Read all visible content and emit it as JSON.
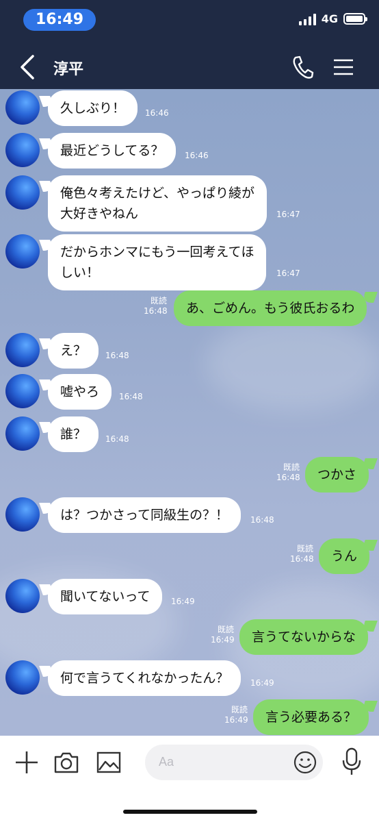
{
  "status_bar": {
    "time": "16:49",
    "network": "4G"
  },
  "header": {
    "title": "淳平"
  },
  "messages": [
    {
      "text": "久しぶり！",
      "time": "16:46"
    },
    {
      "text": "最近どうしてる？",
      "time": "16:46"
    },
    {
      "lines": [
        "俺色々考えたけど、やっぱり綾が",
        "大好きやねん"
      ],
      "time": "16:47"
    },
    {
      "lines": [
        "だからホンマにもう一回考えてほ",
        "しい！"
      ],
      "time": "16:47"
    },
    {
      "text": "あ、ごめん。もう彼氏おるわ",
      "read": "既読",
      "time": "16:48"
    },
    {
      "text": "え？",
      "time": "16:48"
    },
    {
      "text": "嘘やろ",
      "time": "16:48"
    },
    {
      "text": "誰？",
      "time": "16:48"
    },
    {
      "text": "つかさ",
      "read": "既読",
      "time": "16:48"
    },
    {
      "text": "は？つかさって同級生の？！",
      "time": "16:48"
    },
    {
      "text": "うん",
      "read": "既読",
      "time": "16:48"
    },
    {
      "text": "聞いてないって",
      "time": "16:49"
    },
    {
      "text": "言うてないからな",
      "read": "既読",
      "time": "16:49"
    },
    {
      "text": "何で言うてくれなかったん？",
      "time": "16:49"
    },
    {
      "text": "言う必要ある？",
      "read": "既読",
      "time": "16:49"
    }
  ],
  "input": {
    "placeholder": "Aa"
  },
  "icons": {
    "back": "chevron-left-icon",
    "call": "phone-icon",
    "menu": "hamburger-icon",
    "add": "plus-icon",
    "camera": "camera-icon",
    "image": "image-icon",
    "emoji": "smiley-icon",
    "mic": "microphone-icon"
  },
  "colors": {
    "header": "#1f2a44",
    "time_pill": "#2f74e6",
    "outgoing": "#86d86a",
    "incoming": "#ffffff"
  }
}
